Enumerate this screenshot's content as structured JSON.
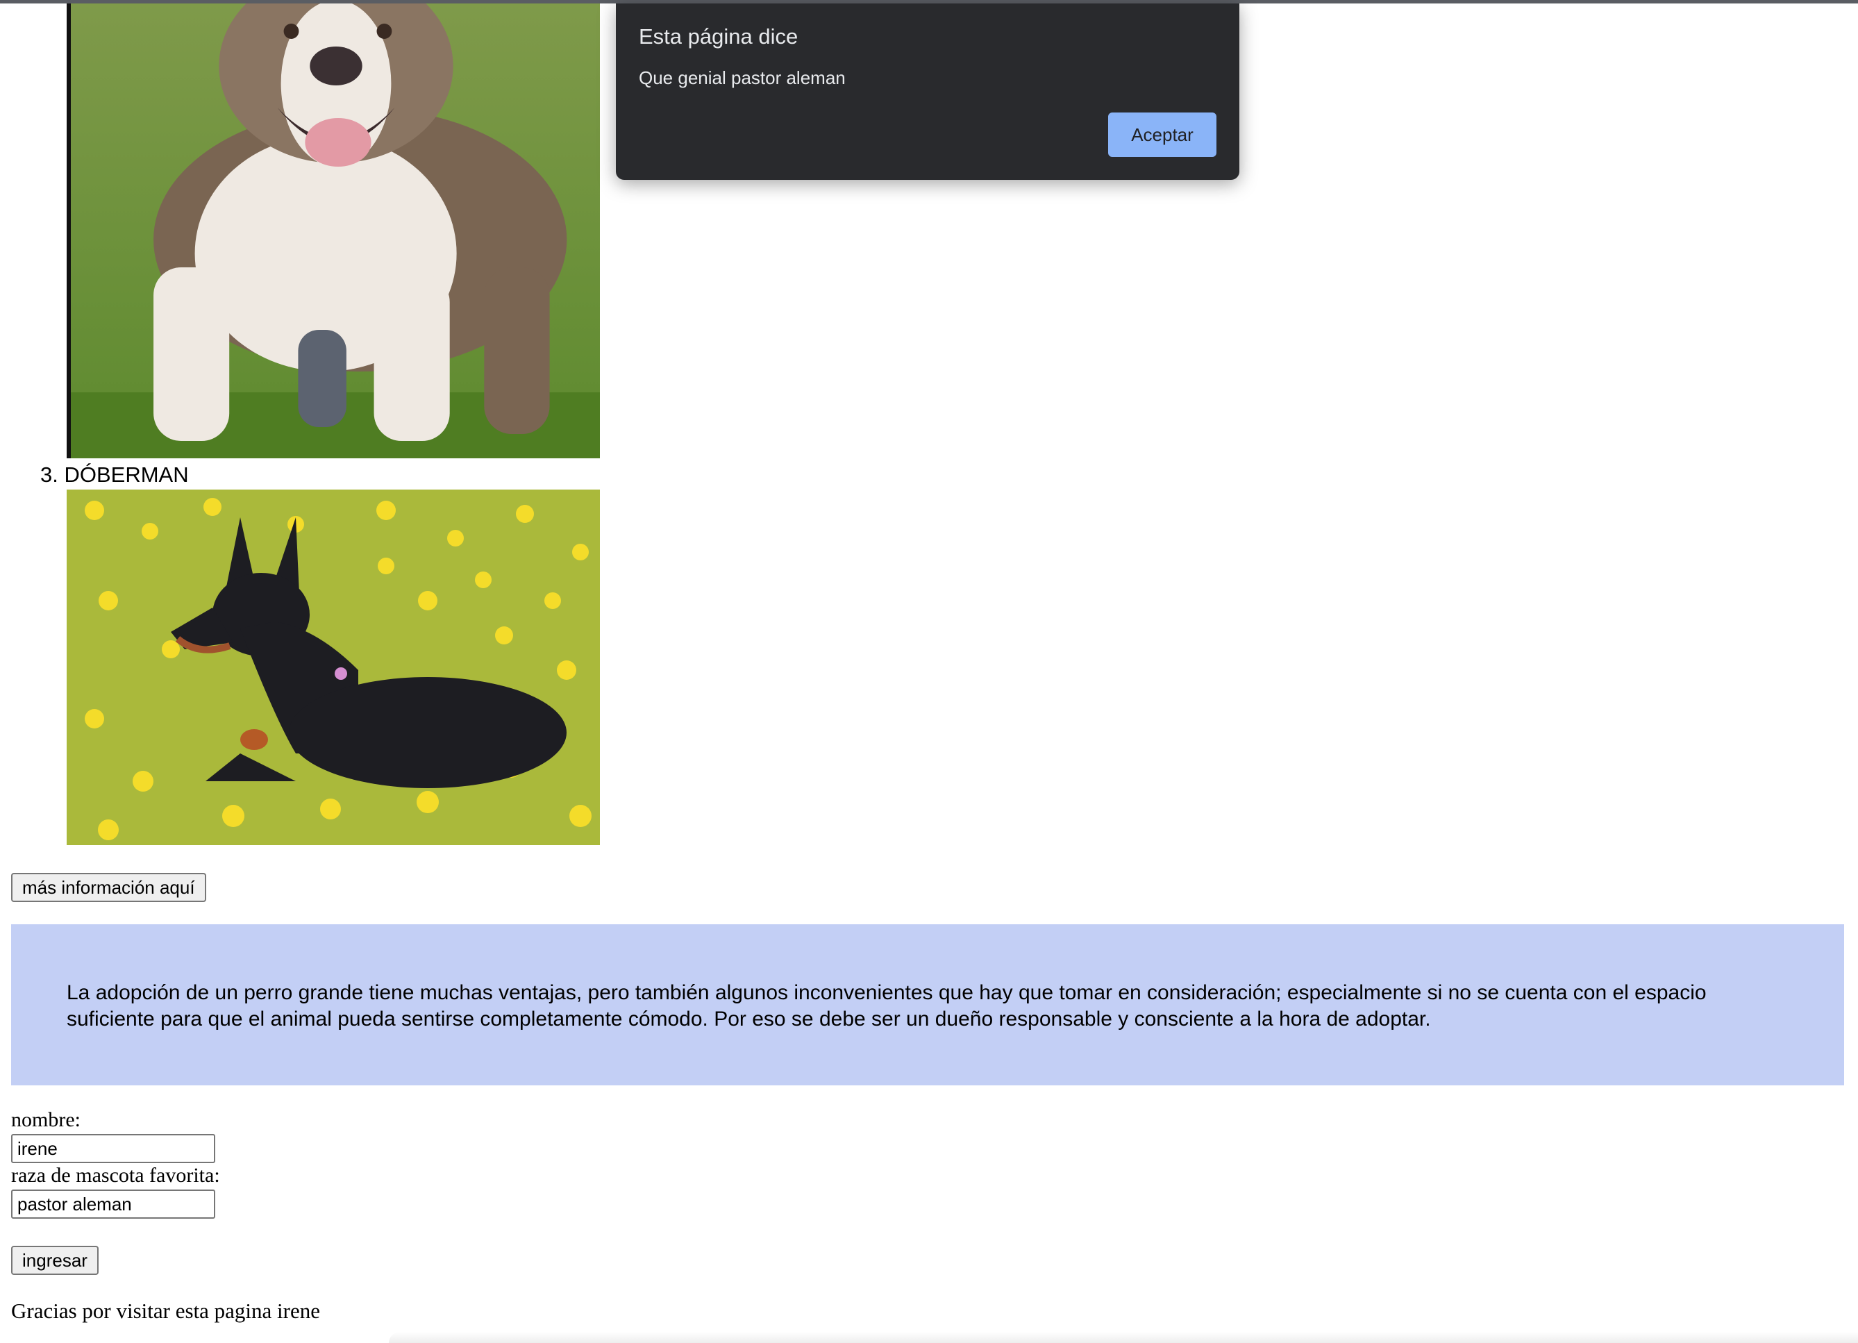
{
  "dialog": {
    "title": "Esta página dice",
    "message": "Que genial pastor aleman",
    "accept_label": "Aceptar"
  },
  "list": {
    "item_3": "3. DÓBERMAN"
  },
  "more_info_button": "más información aquí",
  "info_text": "La adopción de un perro grande tiene muchas ventajas, pero también algunos inconvenientes que hay que tomar en consideración; especialmente si no se cuenta con el espacio suficiente para que el animal pueda sentirse completamente cómodo. Por eso se debe ser un dueño responsable y consciente a la hora de adoptar.",
  "form": {
    "nombre_label": "nombre:",
    "nombre_value": "irene",
    "raza_label": "raza de mascota favorita:",
    "raza_value": "pastor aleman",
    "submit_label": "ingresar"
  },
  "thanks_message": "Gracias por visitar esta pagina irene",
  "colors": {
    "info_box_bg": "#c3cff5",
    "dialog_bg": "#292a2d",
    "dialog_button": "#8ab4f8"
  }
}
